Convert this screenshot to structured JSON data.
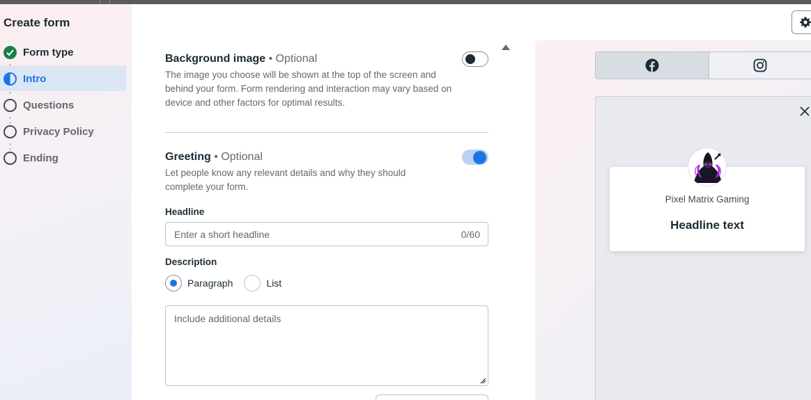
{
  "sidebar": {
    "title": "Create form",
    "steps": [
      {
        "label": "Form type",
        "state": "done"
      },
      {
        "label": "Intro",
        "state": "active"
      },
      {
        "label": "Questions",
        "state": "todo"
      },
      {
        "label": "Privacy Policy",
        "state": "todo"
      },
      {
        "label": "Ending",
        "state": "todo"
      }
    ]
  },
  "background_image": {
    "title": "Background image",
    "optional": "• Optional",
    "description": "The image you choose will be shown at the top of the screen and behind your form. Form rendering and interaction may vary based on device and other factors for optimal results.",
    "enabled": false
  },
  "greeting": {
    "title": "Greeting",
    "optional": "• Optional",
    "description": "Let people know any relevant details and why they should complete your form.",
    "enabled": true,
    "headline_label": "Headline",
    "headline_placeholder": "Enter a short headline",
    "headline_counter": "0/60",
    "description_label": "Description",
    "description_options": [
      "Paragraph",
      "List"
    ],
    "description_selected": "Paragraph",
    "details_placeholder": "Include additional details"
  },
  "preview": {
    "platforms": [
      "facebook-icon",
      "instagram-icon"
    ],
    "selected_platform": "facebook",
    "page_name": "Pixel Matrix Gaming",
    "headline": "Headline text"
  },
  "colors": {
    "accent": "#1b74e4",
    "done": "#1a7f4b",
    "text": "#1c2b33",
    "muted": "#65676b"
  }
}
